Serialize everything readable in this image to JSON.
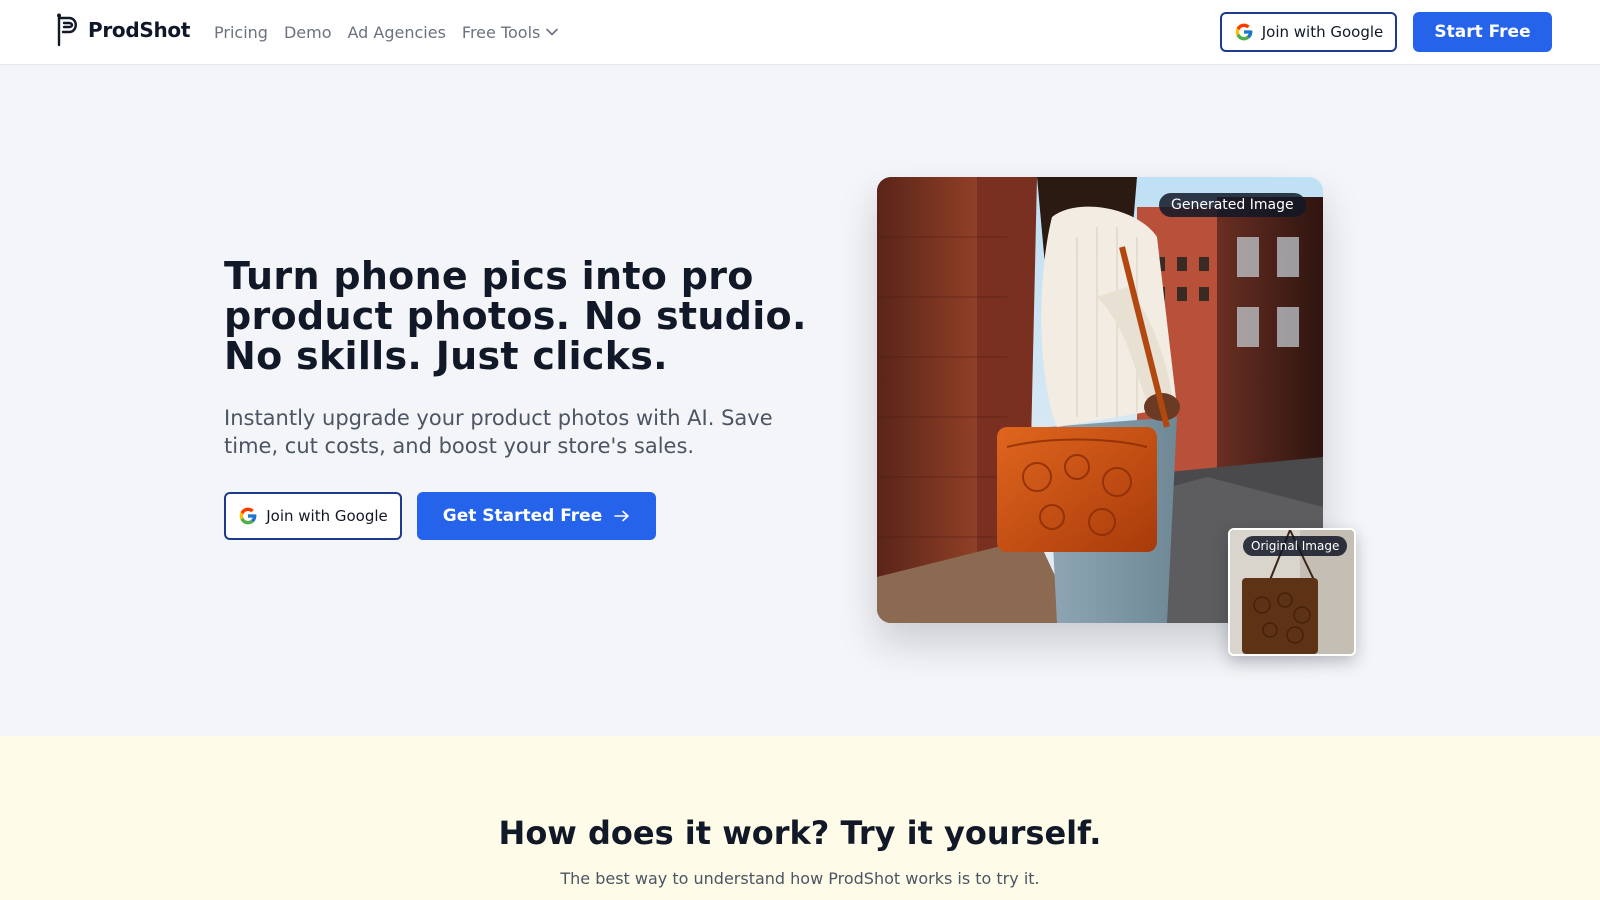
{
  "brand": {
    "name": "ProdShot"
  },
  "nav": {
    "items": [
      {
        "label": "Pricing"
      },
      {
        "label": "Demo"
      },
      {
        "label": "Ad Agencies"
      },
      {
        "label": "Free Tools"
      }
    ]
  },
  "header": {
    "google_button_label": "Join with Google",
    "start_button_label": "Start Free"
  },
  "hero": {
    "title": "Turn phone pics into pro product photos. No studio. No skills. Just clicks.",
    "subtitle": "Instantly upgrade your product photos with AI. Save time, cut costs, and boost your store's sales.",
    "google_button_label": "Join with Google",
    "cta_label": "Get Started Free",
    "generated_badge": "Generated Image",
    "original_badge": "Original Image"
  },
  "how": {
    "title": "How does it work? Try it yourself.",
    "subtitle": "The best way to understand how ProdShot works is to try it."
  },
  "colors": {
    "primary": "#2563eb",
    "outline": "#1e3a8a",
    "page_bg": "#f4f5f8",
    "section_bg": "#fefce8"
  }
}
